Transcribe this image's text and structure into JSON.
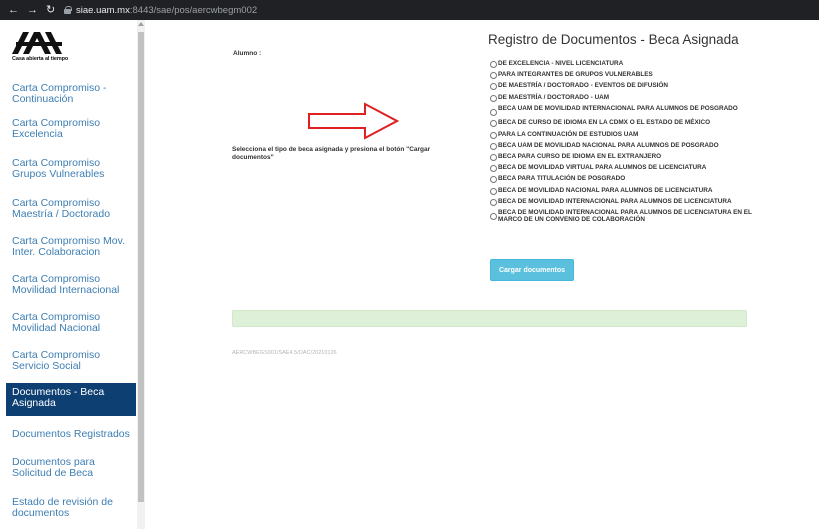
{
  "browser": {
    "url_host": "siae.uam.mx",
    "url_path": ":8443/sae/pos/aercwbegm002"
  },
  "logo": {
    "tagline": "Casa abierta al tiempo"
  },
  "sidebar": {
    "items": [
      {
        "label": "Carta Compromiso - Continuación"
      },
      {
        "label": "Carta Compromiso Excelencia"
      },
      {
        "label": "Carta Compromiso Grupos Vulnerables"
      },
      {
        "label": "Carta Compromiso Maestría / Doctorado"
      },
      {
        "label": "Carta Compromiso Mov. Inter. Colaboracion"
      },
      {
        "label": "Carta Compromiso Movilidad Internacional"
      },
      {
        "label": "Carta Compromiso Movilidad Nacional"
      },
      {
        "label": "Carta Compromiso Servicio Social"
      },
      {
        "label": "Documentos - Beca Asignada",
        "active": true
      },
      {
        "label": "Documentos Registrados"
      },
      {
        "label": "Documentos para Solicitud de Beca"
      },
      {
        "label": "Estado de revisión de documentos"
      }
    ]
  },
  "main": {
    "title": "Registro de Documentos - Beca Asignada",
    "alumno_label": "Alumno :",
    "instruction": "Selecciona el tipo de beca asignada y presiona el botón \"Cargar documentos\"",
    "options": [
      "DE EXCELENCIA - NIVEL LICENCIATURA",
      "PARA INTEGRANTES DE GRUPOS VULNERABLES",
      "DE MAESTRÍA / DOCTORADO - EVENTOS DE DIFUSIÓN",
      "DE MAESTRÍA / DOCTORADO - UAM",
      "BECA UAM DE MOVILIDAD INTERNACIONAL PARA ALUMNOS DE POSGRADO",
      "BECA DE CURSO DE IDIOMA EN LA CDMX O EL ESTADO DE MÉXICO",
      "PARA LA CONTINUACIÓN DE ESTUDIOS UAM",
      "BECA UAM DE MOVILIDAD NACIONAL PARA ALUMNOS DE POSGRADO",
      "BECA PARA CURSO DE IDIOMA EN EL EXTRANJERO",
      "BECA DE MOVILIDAD VIRTUAL PARA ALUMNOS DE LICENCIATURA",
      "BECA PARA TITULACIÓN DE POSGRADO",
      "BECA DE MOVILIDAD NACIONAL PARA ALUMNOS DE LICENCIATURA",
      "BECA DE MOVILIDAD INTERNACIONAL PARA ALUMNOS DE LICENCIATURA",
      "BECA DE MOVILIDAD INTERNACIONAL PARA ALUMNOS DE LICENCIATURA EN EL MARCO DE UN CONVENIO DE COLABORACIÓN"
    ],
    "button_label": "Cargar documentos",
    "footer_code": "AERCWBEGS001/SAE4.5/OAC/20210126"
  },
  "colors": {
    "link": "#3d7eb3",
    "active_bg": "#0d3f73",
    "button": "#5bc0de",
    "alert_bg": "#dff0d8",
    "arrow": "#e02020"
  }
}
